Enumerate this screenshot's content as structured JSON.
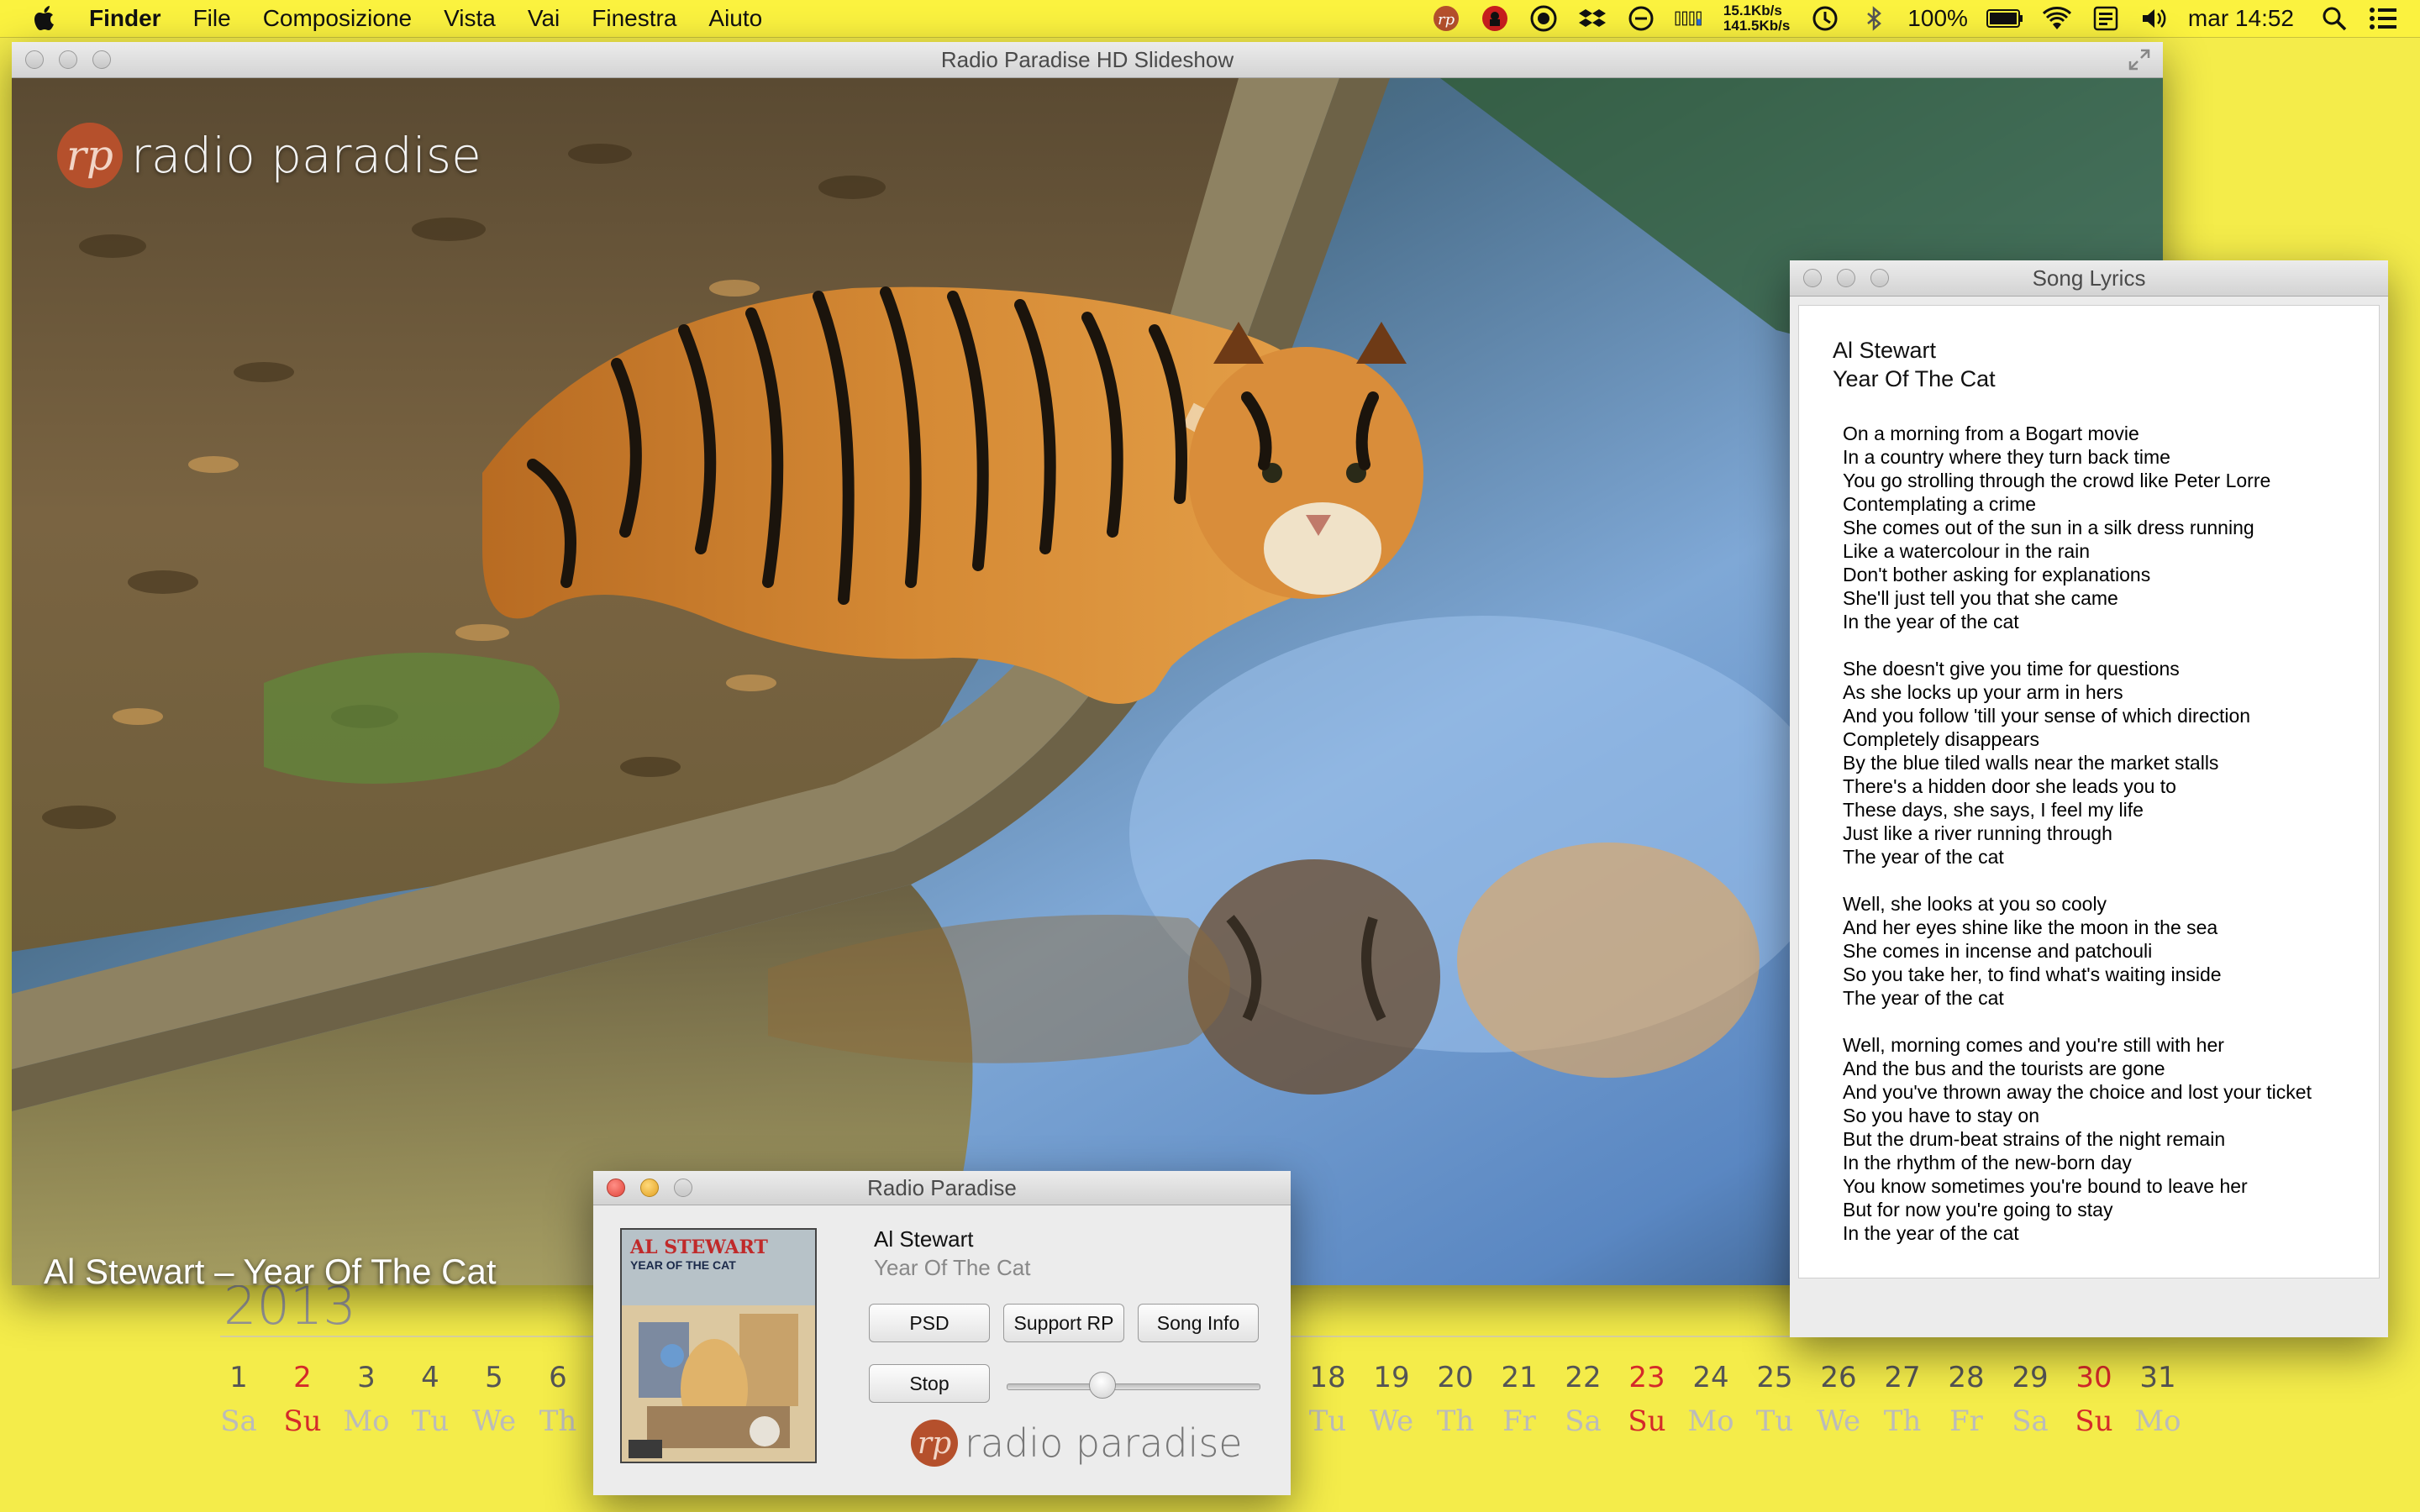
{
  "menubar": {
    "items": [
      "Finder",
      "File",
      "Composizione",
      "Vista",
      "Vai",
      "Finestra",
      "Aiuto"
    ],
    "net_up": "15.1Kb/s",
    "net_down": "141.5Kb/s",
    "battery": "100%",
    "clock": "mar 14:52",
    "icons": [
      "apple-icon",
      "rp-status-icon",
      "lastpass-icon",
      "record-icon",
      "dropbox-icon",
      "sync-icon",
      "memory-gauge-icon",
      "time-machine-icon",
      "bluetooth-icon",
      "battery-icon",
      "wifi-icon",
      "keyboard-icon",
      "volume-icon",
      "spotlight-icon",
      "notification-center-icon"
    ]
  },
  "calendar": {
    "year": "2013",
    "days_left": [
      {
        "num": "1",
        "wd": "Sa",
        "sunday": false
      },
      {
        "num": "2",
        "wd": "Su",
        "sunday": true
      },
      {
        "num": "3",
        "wd": "Mo",
        "sunday": false
      },
      {
        "num": "4",
        "wd": "Tu",
        "sunday": false
      },
      {
        "num": "5",
        "wd": "We",
        "sunday": false
      },
      {
        "num": "6",
        "wd": "Th",
        "sunday": false
      }
    ],
    "days_right": [
      {
        "num": "18",
        "wd": "Tu",
        "sunday": false
      },
      {
        "num": "19",
        "wd": "We",
        "sunday": false
      },
      {
        "num": "20",
        "wd": "Th",
        "sunday": false
      },
      {
        "num": "21",
        "wd": "Fr",
        "sunday": false
      },
      {
        "num": "22",
        "wd": "Sa",
        "sunday": false
      },
      {
        "num": "23",
        "wd": "Su",
        "sunday": true
      },
      {
        "num": "24",
        "wd": "Mo",
        "sunday": false
      },
      {
        "num": "25",
        "wd": "Tu",
        "sunday": false
      },
      {
        "num": "26",
        "wd": "We",
        "sunday": false
      },
      {
        "num": "27",
        "wd": "Th",
        "sunday": false
      },
      {
        "num": "28",
        "wd": "Fr",
        "sunday": false
      },
      {
        "num": "29",
        "wd": "Sa",
        "sunday": false
      },
      {
        "num": "30",
        "wd": "Su",
        "sunday": true
      },
      {
        "num": "31",
        "wd": "Mo",
        "sunday": false
      }
    ]
  },
  "slideshow": {
    "title": "Radio Paradise HD Slideshow",
    "logo_mark": "rp",
    "logo_text": "radio paradise",
    "caption": "Al Stewart – Year Of The Cat"
  },
  "lyrics": {
    "title": "Song Lyrics",
    "artist": "Al Stewart",
    "song": "Year Of The Cat",
    "text": "On a morning from a Bogart movie\nIn a country where they turn back time\nYou go strolling through the crowd like Peter Lorre\nContemplating a crime\nShe comes out of the sun in a silk dress running\nLike a watercolour in the rain\nDon't bother asking for explanations\nShe'll just tell you that she came\nIn the year of the cat\n\nShe doesn't give you time for questions\nAs she locks up your arm in hers\nAnd you follow 'till your sense of which direction\nCompletely disappears\nBy the blue tiled walls near the market stalls\nThere's a hidden door she leads you to\nThese days, she says, I feel my life\nJust like a river running through\nThe year of the cat\n\nWell, she looks at you so cooly\nAnd her eyes shine like the moon in the sea\nShe comes in incense and patchouli\nSo you take her, to find what's waiting inside\nThe year of the cat\n\nWell, morning comes and you're still with her\nAnd the bus and the tourists are gone\nAnd you've thrown away the choice and lost your ticket\nSo you have to stay on\nBut the drum-beat strains of the night remain\nIn the rhythm of the new-born day\nYou know sometimes you're bound to leave her\nBut for now you're going to stay\nIn the year of the cat"
  },
  "player": {
    "title": "Radio Paradise",
    "artist": "Al Stewart",
    "song": "Year Of The Cat",
    "album_art_text": "AL STEWART",
    "album_art_subtext": "YEAR OF THE CAT",
    "buttons": {
      "psd": "PSD",
      "support": "Support RP",
      "info": "Song Info",
      "stop": "Stop"
    },
    "volume": 0.38,
    "logo_mark": "rp",
    "logo_text": "radio paradise"
  }
}
